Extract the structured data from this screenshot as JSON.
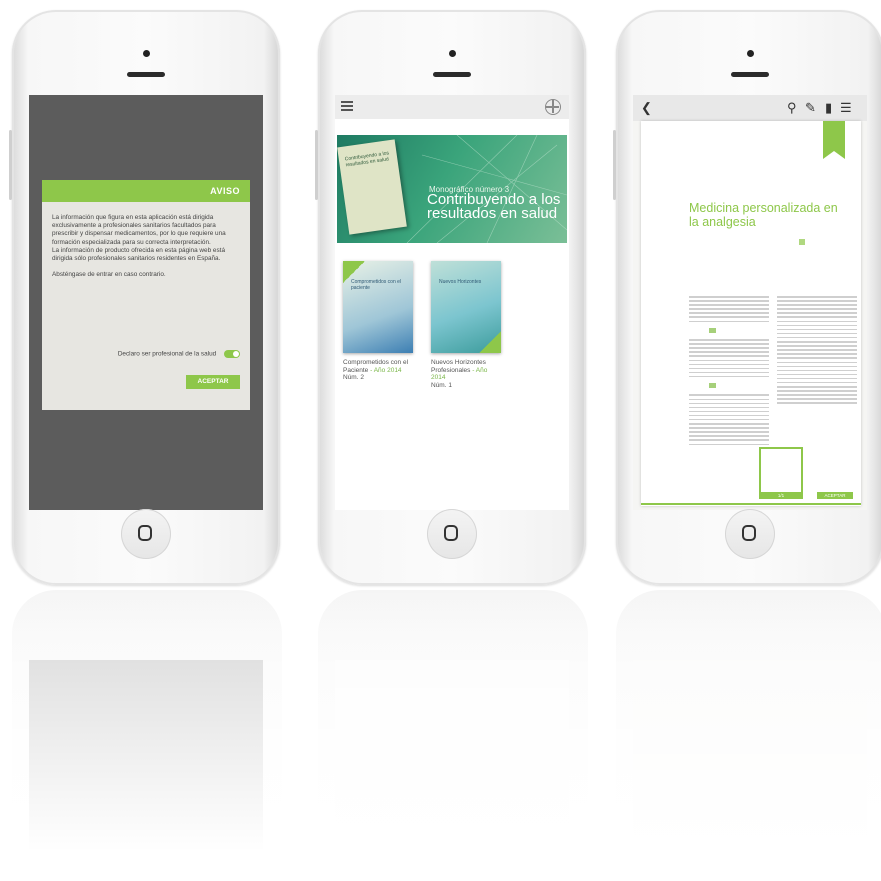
{
  "phone1": {
    "dialog_title": "AVISO",
    "paragraph1": "La información que figura en esta aplicación está dirigida exclusivamente a profesionales sanitarios facultados para prescribir y dispensar medicamentos, por lo que requiere una formación especializada para su correcta interpretación.",
    "paragraph2": "La información de producto ofrecida en esta página web está dirigida sólo profesionales sanitarios residentes en España.",
    "paragraph3": "Absténgase de entrar en caso contrario.",
    "toggle_label": "Declaro ser profesional de la salud",
    "accept_label": "ACEPTAR"
  },
  "phone2": {
    "banner": {
      "book_title": "Contribuyendo a los resultados en salud",
      "subtitle": "Monográfico número 3",
      "title": "Contribuyendo a los resultados en salud"
    },
    "cards": [
      {
        "cover_title": "Comprometidos con el paciente",
        "name": "Comprometidos con el Paciente",
        "year": " - Año 2014",
        "issue": "Núm. 2"
      },
      {
        "cover_title": "Nuevos Horizontes",
        "name": "Nuevos Horizontes Profesionales",
        "year": " - Año 2014",
        "issue": "Núm. 1"
      }
    ]
  },
  "phone3": {
    "article_title": "Medicina personalizada en la analgesia",
    "thumb_label": "1/1",
    "button_label": "ACEPTAR"
  },
  "colors": {
    "accent": "#8ec74a",
    "dark_screen": "#5c5c5c",
    "banner": "#3aa47b"
  },
  "icons": [
    "menu-icon",
    "logo-icon",
    "back-icon",
    "search-icon",
    "edit-icon",
    "bookmark-icon",
    "home-button-icon"
  ]
}
